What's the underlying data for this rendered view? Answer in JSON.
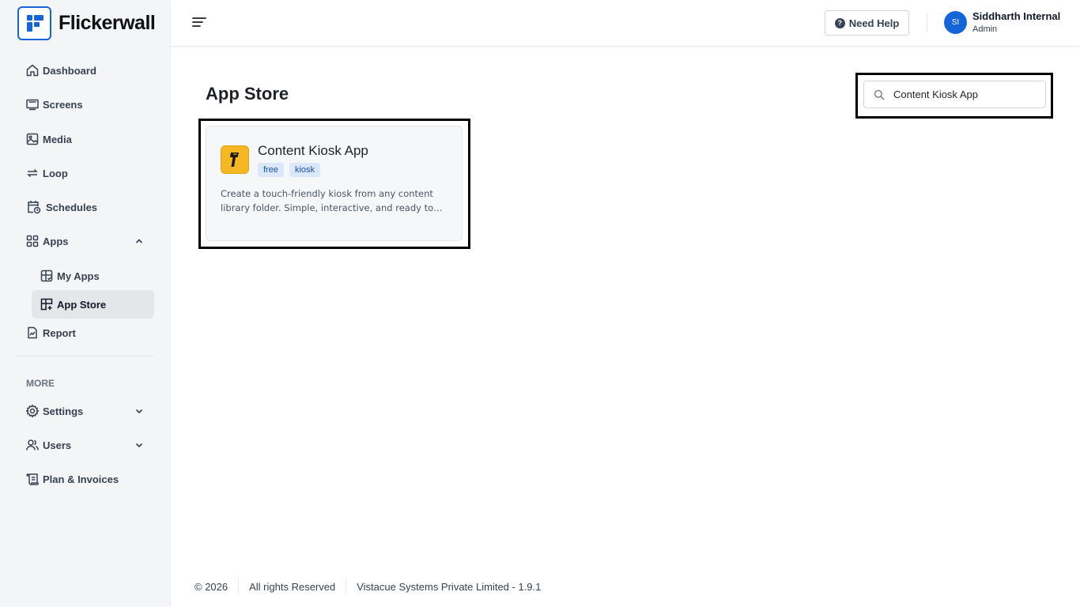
{
  "brand": {
    "name": "Flickerwall"
  },
  "sidebar": {
    "items": [
      {
        "label": "Dashboard"
      },
      {
        "label": "Screens"
      },
      {
        "label": "Media"
      },
      {
        "label": "Loop"
      },
      {
        "label": "Schedules"
      },
      {
        "label": "Apps"
      },
      {
        "label": "My Apps"
      },
      {
        "label": "App Store"
      },
      {
        "label": "Report"
      }
    ],
    "section_more": "MORE",
    "more_items": [
      {
        "label": "Settings"
      },
      {
        "label": "Users"
      },
      {
        "label": "Plan & Invoices"
      }
    ]
  },
  "header": {
    "help_label": "Need Help",
    "user": {
      "initials": "SI",
      "name": "Siddharth Internal",
      "role": "Admin"
    }
  },
  "main": {
    "title": "App Store",
    "search": {
      "value": "Content Kiosk App",
      "placeholder": ""
    },
    "apps": [
      {
        "name": "Content Kiosk App",
        "tags": [
          "free",
          "kiosk"
        ],
        "description": "Create a touch-friendly kiosk from any content library folder. Simple, interactive, and ready to use."
      }
    ]
  },
  "footer": {
    "copyright": "© 2026",
    "rights": "All rights Reserved",
    "company": "Vistacue Systems Private Limited - 1.9.1"
  },
  "colors": {
    "accent": "#1565d8",
    "sidebar_bg": "#f4f5f7",
    "tag_bg": "#dbe7fb",
    "app_icon": "#f5b823"
  }
}
